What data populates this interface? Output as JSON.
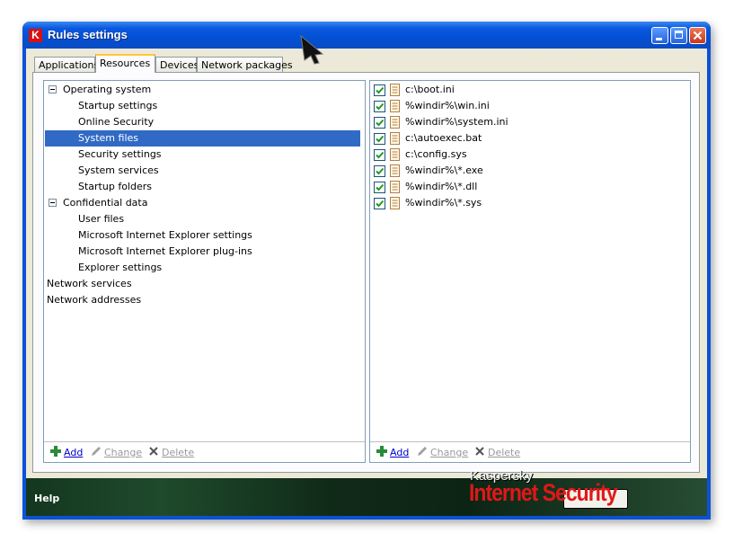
{
  "window": {
    "title": "Rules settings",
    "app_icon": "kaspersky-k-icon"
  },
  "tabs": [
    {
      "label": "Applications",
      "active": false
    },
    {
      "label": "Resources",
      "active": true
    },
    {
      "label": "Devices",
      "active": false
    },
    {
      "label": "Network packages",
      "active": false
    }
  ],
  "tree": [
    {
      "label": "Operating system",
      "level": 0,
      "expander": "minus"
    },
    {
      "label": "Startup settings",
      "level": 2
    },
    {
      "label": "Online Security",
      "level": 2
    },
    {
      "label": "System files",
      "level": 2,
      "selected": true
    },
    {
      "label": "Security settings",
      "level": 2
    },
    {
      "label": "System services",
      "level": 2
    },
    {
      "label": "Startup folders",
      "level": 2
    },
    {
      "label": "Confidential data",
      "level": 0,
      "expander": "minus"
    },
    {
      "label": "User files",
      "level": 2
    },
    {
      "label": "Microsoft Internet Explorer settings",
      "level": 2
    },
    {
      "label": "Microsoft Internet Explorer plug-ins",
      "level": 2
    },
    {
      "label": "Explorer settings",
      "level": 2
    },
    {
      "label": "Network services",
      "level": 1
    },
    {
      "label": "Network addresses",
      "level": 1
    }
  ],
  "files": [
    {
      "path": "c:\\boot.ini",
      "checked": true
    },
    {
      "path": "%windir%\\win.ini",
      "checked": true
    },
    {
      "path": "%windir%\\system.ini",
      "checked": true
    },
    {
      "path": "c:\\autoexec.bat",
      "checked": true
    },
    {
      "path": "c:\\config.sys",
      "checked": true
    },
    {
      "path": "%windir%\\*.exe",
      "checked": true
    },
    {
      "path": "%windir%\\*.dll",
      "checked": true
    },
    {
      "path": "%windir%\\*.sys",
      "checked": true
    }
  ],
  "left_actions": {
    "add": "Add",
    "change": "Change",
    "delete": "Delete"
  },
  "right_actions": {
    "add": "Add",
    "change": "Change",
    "delete": "Delete"
  },
  "footer": {
    "help": "Help",
    "brand_top": "Kaspersky",
    "brand_main": "Internet Security"
  },
  "colors": {
    "selection": "#316ac5",
    "titlebar": "#0a52d8",
    "brand_red": "#e01818",
    "check_green": "#1f9b1f"
  }
}
